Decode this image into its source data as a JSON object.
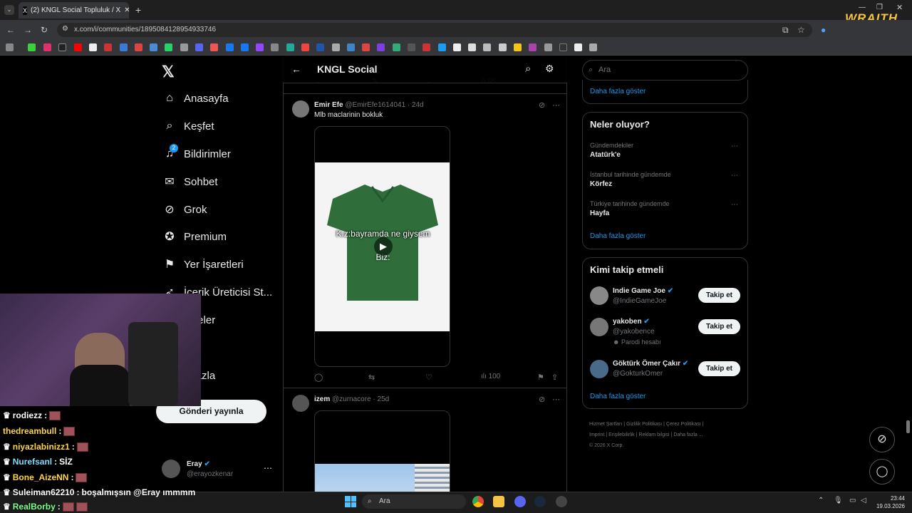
{
  "browser": {
    "tab_title": "(2) KNGL Social Topluluk / X",
    "url": "x.com/i/communities/1895084128954933746",
    "overlay_brand": "WRAITH"
  },
  "sidebar": {
    "items": [
      {
        "label": "Anasayfa",
        "icon": "home-icon"
      },
      {
        "label": "Keşfet",
        "icon": "search-icon"
      },
      {
        "label": "Bildirimler",
        "icon": "bell-icon",
        "badge": "2"
      },
      {
        "label": "Sohbet",
        "icon": "mail-icon"
      },
      {
        "label": "Grok",
        "icon": "grok-icon"
      },
      {
        "label": "Premium",
        "icon": "verified-icon"
      },
      {
        "label": "Yer İşaretleri",
        "icon": "bookmark-icon"
      },
      {
        "label": "İçerik Üreticisi St...",
        "icon": "rocket-icon"
      },
      {
        "label": "kaleler",
        "icon": "list-icon"
      },
      {
        "label": "fil",
        "icon": "profile-icon"
      },
      {
        "label": "a fazla",
        "icon": "more-icon"
      }
    ],
    "post_button": "Gönderi yayınla",
    "account": {
      "name": "Eray",
      "handle": "@erayozkenar"
    }
  },
  "header": {
    "title": "KNGL Social"
  },
  "posts": [
    {
      "name": "Emir Efe",
      "handle": "@EmirEfe1614041",
      "time": "· 24d",
      "text": "Mlb maclarinin bokluk",
      "video_caption_1": "Kız:bayramda ne giysem",
      "video_caption_2": "Biz:",
      "views": "100"
    },
    {
      "name": "izem",
      "handle": "@zurnacore",
      "time": "· 25d"
    }
  ],
  "prev_post_views": "95",
  "right": {
    "search_placeholder": "Ara",
    "show_more_top": "Daha fazla göster",
    "trends_title": "Neler oluyor?",
    "trends": [
      {
        "context": "Gündemdekiler",
        "name": "Atatürk'e"
      },
      {
        "context": "İstanbul tarihinde gündemde",
        "name": "Körfez"
      },
      {
        "context": "Türkiye tarihinde gündemde",
        "name": "Hayfa"
      }
    ],
    "trends_more": "Daha fazla göster",
    "who_title": "Kimi takip etmeli",
    "who": [
      {
        "name": "Indie Game Joe",
        "handle": "@IndieGameJoe",
        "button": "Takip et"
      },
      {
        "name": "yakoben",
        "handle": "@yakobence",
        "note": "Parodi hesabı",
        "button": "Takip et"
      },
      {
        "name": "Göktürk Ömer Çakır",
        "handle": "@GokturkOmer",
        "button": "Takip et"
      }
    ],
    "who_more": "Daha fazla göster",
    "footer": [
      "Hizmet Şartları",
      "Gizlilik Politikası",
      "Çerez Politikası",
      "Imprint",
      "Erişilebilirlik",
      "Reklam bilgisi",
      "Daha fazla ...",
      "© 2026 X Corp."
    ]
  },
  "chat": [
    {
      "user": "rodiezz",
      "msg": "",
      "color": "#ffffff"
    },
    {
      "user": "thedreambull",
      "msg": "",
      "color": "#ffd54a"
    },
    {
      "user": "niyazlabinizz1",
      "msg": "",
      "color": "#ffd54a"
    },
    {
      "user": "Nurefsanl",
      "msg": "SİZ",
      "color": "#7fdcff"
    },
    {
      "user": "Bone_AizeNN",
      "msg": "",
      "color": "#ffd54a"
    },
    {
      "user": "Suleiman62210",
      "msg": "boşalmışsın @Eray ımmmm",
      "color": "#ffffff"
    },
    {
      "user": "RealBorby",
      "msg": "",
      "color": "#7dff8a"
    }
  ],
  "taskbar": {
    "search": "Ara",
    "time": "23:44",
    "date": "19.03.2026"
  }
}
